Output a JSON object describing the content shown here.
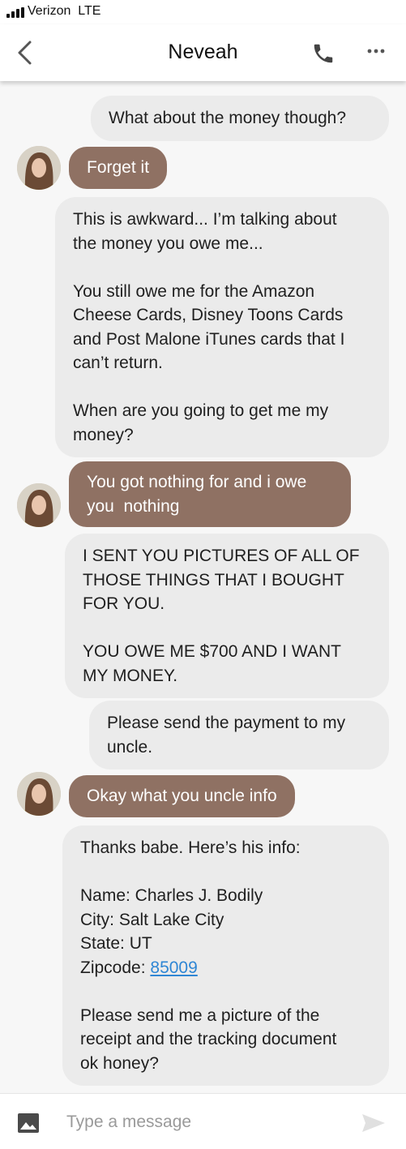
{
  "status_bar": {
    "carrier": "Verizon",
    "network": "LTE"
  },
  "header": {
    "back_icon": "chevron-left-icon",
    "contact_name": "Neveah",
    "call_icon": "phone-icon",
    "more_icon": "ellipsis-icon"
  },
  "messages": [
    {
      "direction": "outgoing",
      "text": "What about the money though?"
    },
    {
      "direction": "incoming",
      "text": "Forget it"
    },
    {
      "direction": "outgoing",
      "text": "This is awkward... I’m talking about\nthe money you owe me...\n\nYou still owe me for the Amazon\nCheese Cards, Disney Toons Cards\nand Post Malone iTunes cards that I\ncan’t return.\n\nWhen are you going to get me my\nmoney?"
    },
    {
      "direction": "incoming",
      "text": "You got nothing for and i owe\nyou  nothing"
    },
    {
      "direction": "outgoing",
      "text": "I SENT YOU PICTURES OF ALL OF\nTHOSE THINGS THAT I BOUGHT\nFOR YOU.\n\nYOU OWE ME $700 AND I WANT\nMY MONEY."
    },
    {
      "direction": "outgoing",
      "text": "Please send the payment to my\nuncle."
    },
    {
      "direction": "incoming",
      "text": "Okay what you uncle info"
    },
    {
      "direction": "outgoing",
      "text_before_link": "Thanks babe. Here’s his info:\n\nName: Charles J. Bodily\nCity: Salt Lake City\nState: UT\nZipcode: ",
      "link": "85009",
      "text_after_link": "\n\nPlease send me a picture of the\nreceipt and the tracking document\nok honey?"
    }
  ],
  "composer": {
    "placeholder": "Type a message",
    "image_icon": "image-icon",
    "send_icon": "send-icon"
  },
  "colors": {
    "incoming_bubble": "#8f7163",
    "outgoing_bubble": "#ebebeb",
    "link": "#2f86d4",
    "chat_background": "#f7f7f7"
  }
}
